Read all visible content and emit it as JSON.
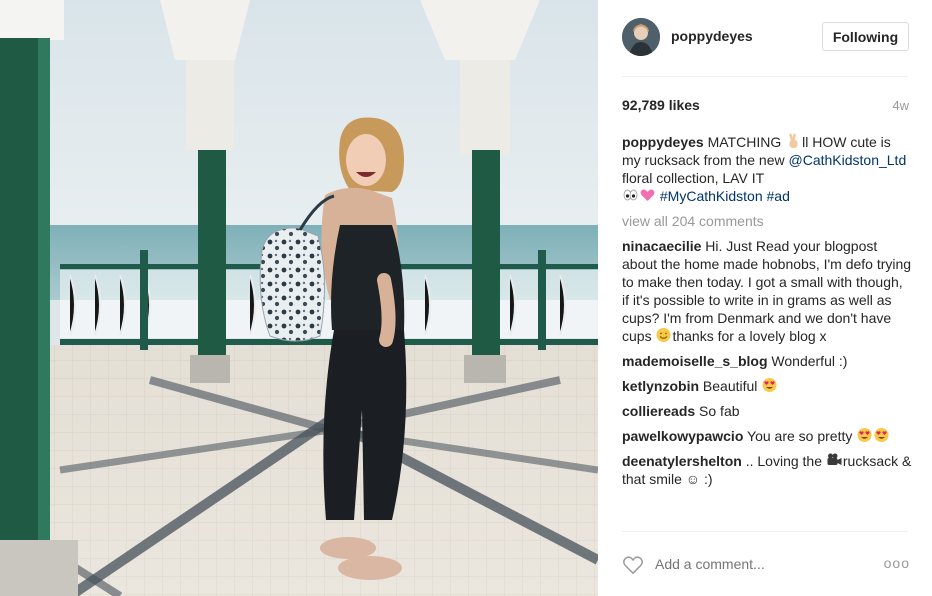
{
  "post": {
    "username": "poppydeyes",
    "follow_label": "Following",
    "likes": "92,789 likes",
    "age": "4w",
    "caption": {
      "user": "poppydeyes",
      "text_1": "MATCHING",
      "emoji_1": "victory-hand",
      "text_2": "ll HOW cute is my rucksack from the new",
      "mention": "@CathKidston_Ltd",
      "text_3": "floral collection, LAV IT",
      "emoji_2": "eyes",
      "emoji_3": "pink-heart",
      "hashtag_1": "#MyCathKidston",
      "hashtag_2": "#ad"
    },
    "view_all": "view all 204 comments",
    "comments": [
      {
        "user": "ninacaecilie",
        "text": "Hi. Just Read your blogpost about the home made hobnobs, I'm defo trying to make then today. I got a small with though, if it's possible to write in in grams as well as cups? I'm from Denmark and we don't have cups",
        "emoji": "smiling-face",
        "text_after": "thanks for a lovely blog x"
      },
      {
        "user": "mademoiselle_s_blog",
        "text": "Wonderful :)"
      },
      {
        "user": "ketlynzobin",
        "text": "Beautiful",
        "emoji": "heart-eyes"
      },
      {
        "user": "colliereads",
        "text": "So fab"
      },
      {
        "user": "pawelkowypawcio",
        "text": "You are so pretty",
        "emoji": "heart-eyes",
        "emoji_count": 2
      },
      {
        "user": "deenatylershelton",
        "text": ".. Loving the",
        "emoji": "movie-camera",
        "text_after": "rucksack & that smile ☺ :)"
      }
    ],
    "comment_placeholder": "Add a comment...",
    "more_label": "ooo"
  },
  "icons": {
    "like": "heart-outline-icon",
    "more": "more-options-icon"
  },
  "colors": {
    "link": "#003569",
    "muted": "#999999",
    "border": "#dbdbdb",
    "text": "#262626"
  }
}
